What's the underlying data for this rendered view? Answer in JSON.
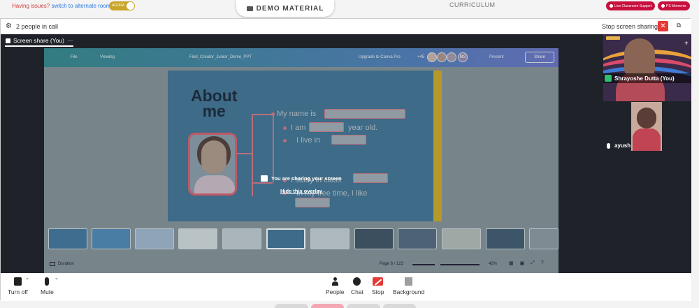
{
  "topbar": {
    "issues_text": "Having issues?",
    "alternate_link": "switch to alternate room",
    "toggle_label": "AGORA",
    "demo_material": "DEMO MATERIAL",
    "curriculum": "CURRICULUM",
    "live_support": "Live Classroom Support",
    "ps_moments": "PS Moments"
  },
  "call": {
    "people_count": "2 people in call",
    "stop_sharing": "Stop screen sharing",
    "close_symbol": "✕",
    "screen_share_tab": "Screen share (You)",
    "tab_more": "···"
  },
  "shared_screen": {
    "canva": {
      "file": "File",
      "viewing": "Viewing",
      "doc_title": "Find_Creator_Junior_Demo_PPT",
      "upgrade": "Upgrade to Canva Pro",
      "count": "+45",
      "avatar_initials": "MS",
      "present": "Present",
      "share": "Share"
    },
    "slide": {
      "about_line1": "About",
      "about_line2": "me",
      "line_name": "My name is",
      "line_age_a": "I am",
      "line_age_b": "year old.",
      "line_live": "I live in",
      "line_class": "I study in class",
      "line_free": "In my free time, I like"
    },
    "overlay_message": "You are sharing your screen",
    "overlay_hide": "Hide this overlay",
    "footer": {
      "duration": "Duration",
      "page": "Page 6 / 123",
      "zoom": "42%"
    }
  },
  "participants": [
    {
      "name": "Shrayoshe Dutta (You)"
    },
    {
      "name": "ayush"
    }
  ],
  "controls": {
    "turn_off": "Turn off",
    "mute": "Mute",
    "people": "People",
    "chat": "Chat",
    "stop": "Stop",
    "background": "Background"
  },
  "colors": {
    "accent_red": "#e53935",
    "pill_red": "#c8103e",
    "stage_dark": "#1f2329",
    "toggle_gold": "#c8a428"
  }
}
